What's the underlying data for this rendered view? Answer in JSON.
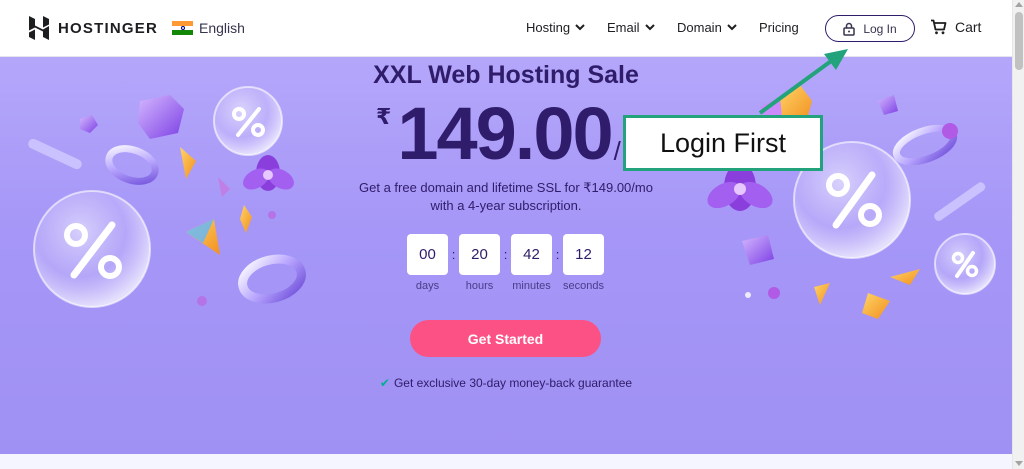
{
  "brand": {
    "name": "HOSTINGER"
  },
  "language": {
    "label": "English",
    "flag_icon": "india-flag-icon"
  },
  "nav": {
    "items": [
      {
        "label": "Hosting",
        "has_dropdown": true
      },
      {
        "label": "Email",
        "has_dropdown": true
      },
      {
        "label": "Domain",
        "has_dropdown": true
      },
      {
        "label": "Pricing",
        "has_dropdown": false
      }
    ],
    "login_label": "Log In",
    "cart_label": "Cart"
  },
  "hero": {
    "title": "XXL Web Hosting Sale",
    "currency": "₹",
    "price": "149.00",
    "per": "/",
    "description_line1": "Get a free domain and lifetime SSL for ₹149.00/mo",
    "description_line2": "with a 4-year subscription.",
    "countdown": [
      {
        "value": "00",
        "label": "days"
      },
      {
        "value": "20",
        "label": "hours"
      },
      {
        "value": "42",
        "label": "minutes"
      },
      {
        "value": "12",
        "label": "seconds"
      }
    ],
    "cta_label": "Get Started",
    "guarantee": "Get exclusive 30-day money-back guarantee"
  },
  "annotation": {
    "text": "Login First"
  },
  "colors": {
    "brand_dark": "#2f1c6a",
    "cta_pink": "#fc5185",
    "hero_bg": "#a596f7",
    "annotation_green": "#22a37c",
    "check_green": "#00b090"
  }
}
